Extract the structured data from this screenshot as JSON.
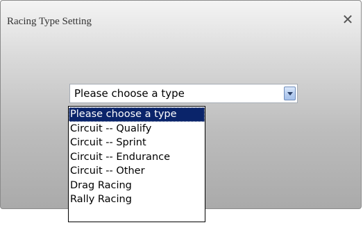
{
  "dialog": {
    "title": "Racing Type Setting",
    "close_glyph": "✕"
  },
  "select": {
    "value": "Please choose a type",
    "options": [
      "Please choose a type",
      "Circuit -- Qualify",
      "Circuit -- Sprint",
      "Circuit -- Endurance",
      "Circuit -- Other",
      "Drag Racing",
      "Rally Racing"
    ],
    "selected_index": 0
  },
  "colors": {
    "highlight": "#0a246a",
    "arrow_button": "#b9cff0"
  }
}
